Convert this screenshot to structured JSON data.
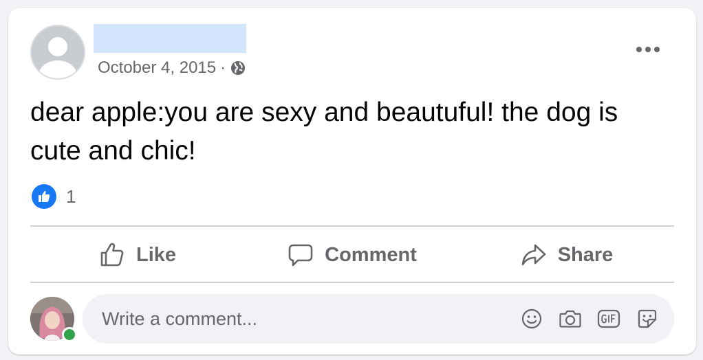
{
  "post": {
    "date": "October 4, 2015",
    "separator": "·",
    "privacy_icon": "globe-icon",
    "text": "dear apple:you are sexy and beautuful! the dog is cute and chic!",
    "reactions": {
      "icon": "like-icon",
      "count": "1"
    }
  },
  "actions": {
    "like": "Like",
    "comment": "Comment",
    "share": "Share"
  },
  "composer": {
    "placeholder": "Write a comment...",
    "tools": [
      "emoji-icon",
      "camera-icon",
      "gif-icon",
      "sticker-icon"
    ]
  },
  "colors": {
    "accent": "#1877f2",
    "secondary_text": "#65676b",
    "online": "#31a24c"
  }
}
